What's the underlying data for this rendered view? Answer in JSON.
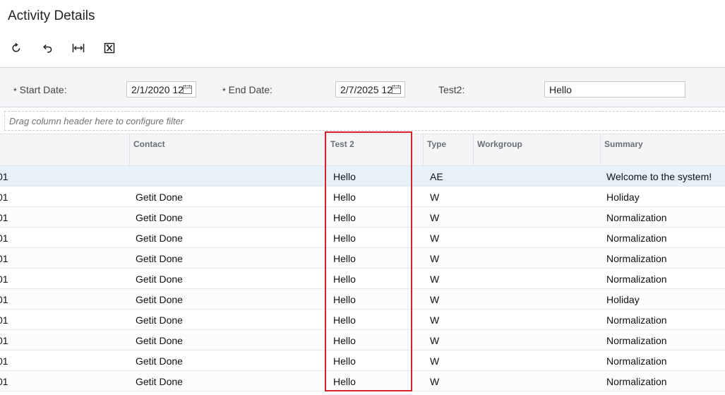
{
  "page": {
    "title": "Activity Details"
  },
  "toolbar": {
    "buttons": [
      {
        "name": "refresh-button",
        "icon": "refresh-icon"
      },
      {
        "name": "undo-button",
        "icon": "undo-icon"
      },
      {
        "name": "fit-columns-button",
        "icon": "fit-width-icon"
      },
      {
        "name": "export-excel-button",
        "icon": "excel-export-icon"
      }
    ]
  },
  "filters": {
    "start_date": {
      "label": "Start Date:",
      "value": "2/1/2020 12"
    },
    "end_date": {
      "label": "End Date:",
      "value": "2/7/2025 12"
    },
    "test2": {
      "label": "Test2:",
      "value": "Hello"
    },
    "required_marker": "*"
  },
  "group_bar": {
    "placeholder": "Drag column header here to configure filter"
  },
  "grid": {
    "columns": [
      "",
      "Contact",
      "Test 2",
      "Type",
      "Workgroup",
      "Summary"
    ],
    "rows": [
      {
        "id": "01",
        "contact": "",
        "test2": "Hello",
        "type": "AE",
        "workgroup": "",
        "summary": "Welcome to the system!"
      },
      {
        "id": "01",
        "contact": "Getit Done",
        "test2": "Hello",
        "type": "W",
        "workgroup": "",
        "summary": "Holiday"
      },
      {
        "id": "01",
        "contact": "Getit Done",
        "test2": "Hello",
        "type": "W",
        "workgroup": "",
        "summary": "Normalization"
      },
      {
        "id": "01",
        "contact": "Getit Done",
        "test2": "Hello",
        "type": "W",
        "workgroup": "",
        "summary": "Normalization"
      },
      {
        "id": "01",
        "contact": "Getit Done",
        "test2": "Hello",
        "type": "W",
        "workgroup": "",
        "summary": "Normalization"
      },
      {
        "id": "01",
        "contact": "Getit Done",
        "test2": "Hello",
        "type": "W",
        "workgroup": "",
        "summary": "Normalization"
      },
      {
        "id": "01",
        "contact": "Getit Done",
        "test2": "Hello",
        "type": "W",
        "workgroup": "",
        "summary": "Holiday"
      },
      {
        "id": "01",
        "contact": "Getit Done",
        "test2": "Hello",
        "type": "W",
        "workgroup": "",
        "summary": "Normalization"
      },
      {
        "id": "01",
        "contact": "Getit Done",
        "test2": "Hello",
        "type": "W",
        "workgroup": "",
        "summary": "Normalization"
      },
      {
        "id": "01",
        "contact": "Getit Done",
        "test2": "Hello",
        "type": "W",
        "workgroup": "",
        "summary": "Normalization"
      },
      {
        "id": "01",
        "contact": "Getit Done",
        "test2": "Hello",
        "type": "W",
        "workgroup": "",
        "summary": "Normalization"
      }
    ]
  },
  "colors": {
    "highlight": "#d6232b",
    "selected_row": "#e6f1fa",
    "header_bg": "#f4f5f7"
  }
}
